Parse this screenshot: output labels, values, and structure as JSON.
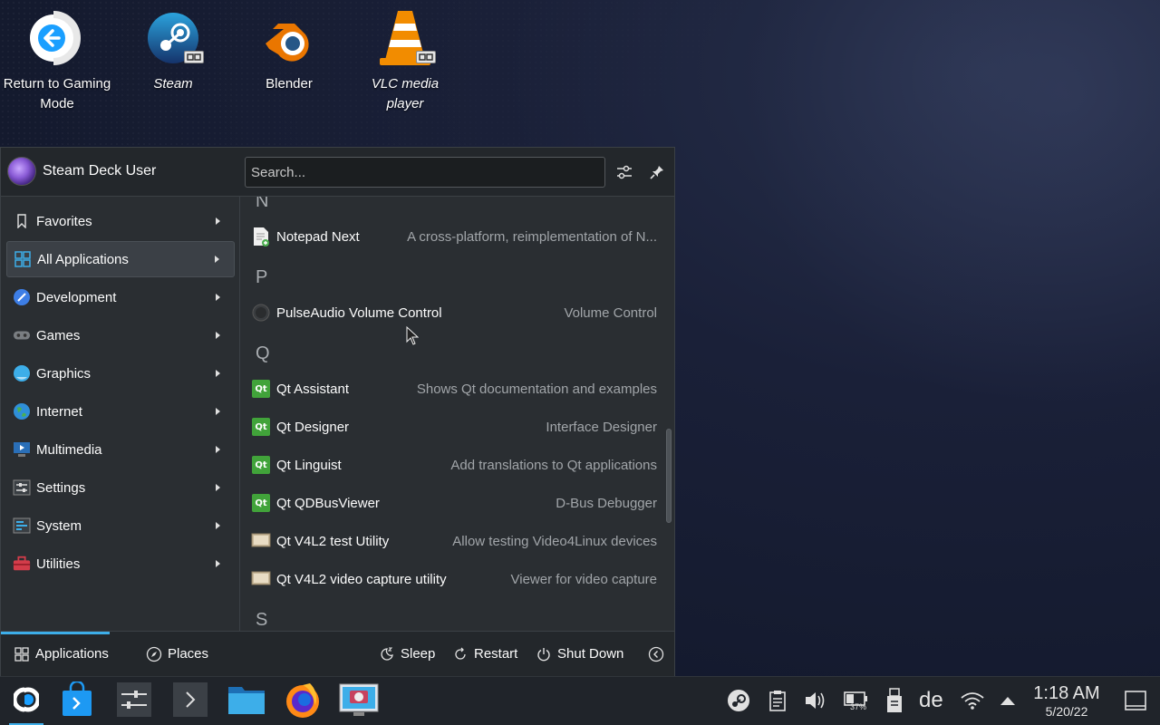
{
  "desktop": {
    "icons": [
      {
        "label": "Return to Gaming Mode",
        "italic": false
      },
      {
        "label": "Steam",
        "italic": true
      },
      {
        "label": "Blender",
        "italic": false
      },
      {
        "label": "VLC media player",
        "italic": true
      }
    ]
  },
  "launcher": {
    "user_name": "Steam Deck User",
    "search_placeholder": "Search...",
    "categories": [
      {
        "label": "Favorites",
        "icon": "bookmark-icon",
        "active": false
      },
      {
        "label": "All Applications",
        "icon": "grid-icon",
        "active": true
      },
      {
        "label": "Development",
        "icon": "development-icon",
        "active": false
      },
      {
        "label": "Games",
        "icon": "gamepad-icon",
        "active": false
      },
      {
        "label": "Graphics",
        "icon": "graphics-icon",
        "active": false
      },
      {
        "label": "Internet",
        "icon": "globe-icon",
        "active": false
      },
      {
        "label": "Multimedia",
        "icon": "multimedia-icon",
        "active": false
      },
      {
        "label": "Settings",
        "icon": "settings-icon",
        "active": false
      },
      {
        "label": "System",
        "icon": "system-icon",
        "active": false
      },
      {
        "label": "Utilities",
        "icon": "toolbox-icon",
        "active": false
      }
    ],
    "apps": {
      "sections": [
        {
          "letter": "N",
          "items": [
            {
              "name": "Notepad Next",
              "desc": "A cross-platform, reimplementation of N...",
              "icon": "notepad-icon"
            }
          ]
        },
        {
          "letter": "P",
          "items": [
            {
              "name": "PulseAudio Volume Control",
              "desc": "Volume Control",
              "icon": "volume-knob-icon"
            }
          ]
        },
        {
          "letter": "Q",
          "items": [
            {
              "name": "Qt Assistant",
              "desc": "Shows Qt documentation and examples",
              "icon": "qt-icon"
            },
            {
              "name": "Qt Designer",
              "desc": "Interface Designer",
              "icon": "qt-icon"
            },
            {
              "name": "Qt Linguist",
              "desc": "Add translations to Qt applications",
              "icon": "qt-icon"
            },
            {
              "name": "Qt QDBusViewer",
              "desc": "D-Bus Debugger",
              "icon": "qt-icon"
            },
            {
              "name": "Qt V4L2 test Utility",
              "desc": "Allow testing Video4Linux devices",
              "icon": "monitor-icon"
            },
            {
              "name": "Qt V4L2 video capture utility",
              "desc": "Viewer for video capture",
              "icon": "monitor-icon"
            }
          ]
        },
        {
          "letter": "S",
          "items": []
        }
      ]
    },
    "footer": {
      "tab_applications": "Applications",
      "tab_places": "Places",
      "sleep": "Sleep",
      "restart": "Restart",
      "shutdown": "Shut Down"
    }
  },
  "taskbar": {
    "language": "de",
    "battery_percent": "37%",
    "time": "1:18 AM",
    "date": "5/20/22"
  },
  "colors": {
    "accent": "#3daee9",
    "panel_bg": "#2a2e32",
    "header_bg": "#23272b",
    "qt_green": "#41a33a"
  }
}
